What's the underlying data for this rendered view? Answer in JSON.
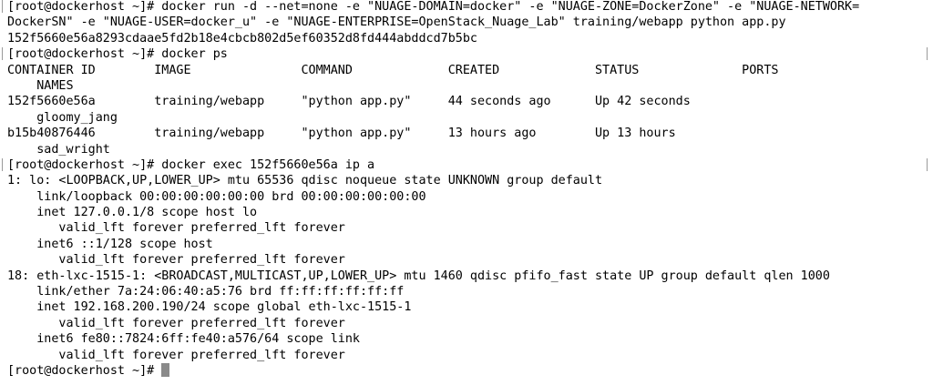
{
  "terminal": {
    "lines": [
      "[root@dockerhost ~]# docker run -d --net=none -e \"NUAGE-DOMAIN=docker\" -e \"NUAGE-ZONE=DockerZone\" -e \"NUAGE-NETWORK=",
      "DockerSN\" -e \"NUAGE-USER=docker_u\" -e \"NUAGE-ENTERPRISE=OpenStack_Nuage_Lab\" training/webapp python app.py",
      "152f5660e56a8293cdaae5fd2b18e4cbcb802d5ef60352d8fd444abddcd7b5bc",
      "[root@dockerhost ~]# docker ps",
      "CONTAINER ID        IMAGE               COMMAND             CREATED             STATUS              PORTS",
      "    NAMES",
      "152f5660e56a        training/webapp     \"python app.py\"     44 seconds ago      Up 42 seconds",
      "    gloomy_jang",
      "b15b40876446        training/webapp     \"python app.py\"     13 hours ago        Up 13 hours",
      "    sad_wright",
      "[root@dockerhost ~]# docker exec 152f5660e56a ip a",
      "1: lo: <LOOPBACK,UP,LOWER_UP> mtu 65536 qdisc noqueue state UNKNOWN group default",
      "    link/loopback 00:00:00:00:00:00 brd 00:00:00:00:00:00",
      "    inet 127.0.0.1/8 scope host lo",
      "       valid_lft forever preferred_lft forever",
      "    inet6 ::1/128 scope host",
      "       valid_lft forever preferred_lft forever",
      "18: eth-lxc-1515-1: <BROADCAST,MULTICAST,UP,LOWER_UP> mtu 1460 qdisc pfifo_fast state UP group default qlen 1000",
      "    link/ether 7a:24:06:40:a5:76 brd ff:ff:ff:ff:ff:ff",
      "    inet 192.168.200.190/24 scope global eth-lxc-1515-1",
      "       valid_lft forever preferred_lft forever",
      "    inet6 fe80::7824:6ff:fe40:a576/64 scope link",
      "       valid_lft forever preferred_lft forever",
      "[root@dockerhost ~]# "
    ]
  }
}
